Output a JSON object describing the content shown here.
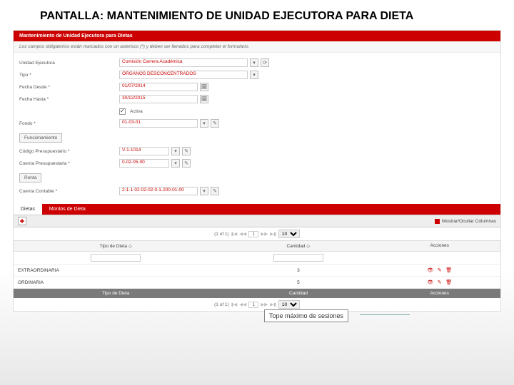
{
  "slide": {
    "title": "PANTALLA: MANTENIMIENTO DE UNIDAD EJECUTORA PARA DIETA"
  },
  "header": {
    "title": "Mantenimiento de Unidad Ejecutora para Dietas"
  },
  "help": "Los campos obligatorios están marcados con un asterisco (*) y deben ser llenados para completar el formulario.",
  "fields": {
    "unidad_label": "Unidad Ejecutora",
    "unidad_value": "Comisión Carrera Académica",
    "tipo_label": "Tipo *",
    "tipo_value": "ÓRGANOS DESCONCENTRADOS",
    "fecha_desde_label": "Fecha Desde *",
    "fecha_desde_value": "01/07/2014",
    "fecha_hasta_label": "Fecha Hasta *",
    "fecha_hasta_value": "30/12/2015",
    "activa_label": "Activa",
    "fondo_label": "Fondo *",
    "fondo_value": "01-03-01",
    "func_section": "Funcionamiento",
    "codpres_label": "Código Presupuestario *",
    "codpres_value": "V-1-1014",
    "cuentapres_label": "Cuenta Presupuestaria *",
    "cuentapres_value": "0-02-05-00",
    "renta_section": "Renta",
    "cuentacont_label": "Cuenta Contable *",
    "cuentacont_value": "2-1-1-02-02-02-0-1-200-01-00"
  },
  "tabs": {
    "t1": "Dietas",
    "t2": "Montos de Dieta"
  },
  "toolbar": {
    "showcols": "Mostrar/Ocultar Columnas"
  },
  "pager": {
    "info_top": "(1 of 1)",
    "info_bottom": "(1 of 1)",
    "page": "1",
    "size": "10"
  },
  "table": {
    "col_tipo": "Tipo de Dieta",
    "col_cant": "Cantidad",
    "col_acc": "Acciones",
    "sort": "◇"
  },
  "rows": [
    {
      "tipo": "EXTRAORDINARIA",
      "cant": "3"
    },
    {
      "tipo": "ORDINARIA",
      "cant": "5"
    }
  ],
  "footer": {
    "col_tipo": "Tipo de Dieta",
    "col_cant": "Cantidad",
    "col_acc": "Acciones"
  },
  "callout": {
    "text": "Tope máximo de sesiones"
  }
}
